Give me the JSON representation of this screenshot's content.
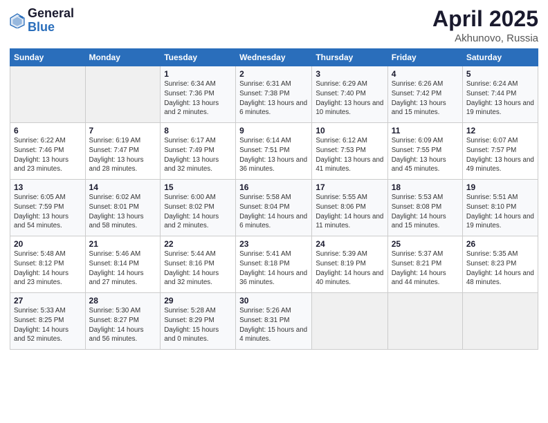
{
  "logo": {
    "general": "General",
    "blue": "Blue"
  },
  "title": {
    "month": "April 2025",
    "location": "Akhunovo, Russia"
  },
  "headers": [
    "Sunday",
    "Monday",
    "Tuesday",
    "Wednesday",
    "Thursday",
    "Friday",
    "Saturday"
  ],
  "weeks": [
    [
      {
        "day": "",
        "info": ""
      },
      {
        "day": "",
        "info": ""
      },
      {
        "day": "1",
        "info": "Sunrise: 6:34 AM\nSunset: 7:36 PM\nDaylight: 13 hours and 2 minutes."
      },
      {
        "day": "2",
        "info": "Sunrise: 6:31 AM\nSunset: 7:38 PM\nDaylight: 13 hours and 6 minutes."
      },
      {
        "day": "3",
        "info": "Sunrise: 6:29 AM\nSunset: 7:40 PM\nDaylight: 13 hours and 10 minutes."
      },
      {
        "day": "4",
        "info": "Sunrise: 6:26 AM\nSunset: 7:42 PM\nDaylight: 13 hours and 15 minutes."
      },
      {
        "day": "5",
        "info": "Sunrise: 6:24 AM\nSunset: 7:44 PM\nDaylight: 13 hours and 19 minutes."
      }
    ],
    [
      {
        "day": "6",
        "info": "Sunrise: 6:22 AM\nSunset: 7:46 PM\nDaylight: 13 hours and 23 minutes."
      },
      {
        "day": "7",
        "info": "Sunrise: 6:19 AM\nSunset: 7:47 PM\nDaylight: 13 hours and 28 minutes."
      },
      {
        "day": "8",
        "info": "Sunrise: 6:17 AM\nSunset: 7:49 PM\nDaylight: 13 hours and 32 minutes."
      },
      {
        "day": "9",
        "info": "Sunrise: 6:14 AM\nSunset: 7:51 PM\nDaylight: 13 hours and 36 minutes."
      },
      {
        "day": "10",
        "info": "Sunrise: 6:12 AM\nSunset: 7:53 PM\nDaylight: 13 hours and 41 minutes."
      },
      {
        "day": "11",
        "info": "Sunrise: 6:09 AM\nSunset: 7:55 PM\nDaylight: 13 hours and 45 minutes."
      },
      {
        "day": "12",
        "info": "Sunrise: 6:07 AM\nSunset: 7:57 PM\nDaylight: 13 hours and 49 minutes."
      }
    ],
    [
      {
        "day": "13",
        "info": "Sunrise: 6:05 AM\nSunset: 7:59 PM\nDaylight: 13 hours and 54 minutes."
      },
      {
        "day": "14",
        "info": "Sunrise: 6:02 AM\nSunset: 8:01 PM\nDaylight: 13 hours and 58 minutes."
      },
      {
        "day": "15",
        "info": "Sunrise: 6:00 AM\nSunset: 8:02 PM\nDaylight: 14 hours and 2 minutes."
      },
      {
        "day": "16",
        "info": "Sunrise: 5:58 AM\nSunset: 8:04 PM\nDaylight: 14 hours and 6 minutes."
      },
      {
        "day": "17",
        "info": "Sunrise: 5:55 AM\nSunset: 8:06 PM\nDaylight: 14 hours and 11 minutes."
      },
      {
        "day": "18",
        "info": "Sunrise: 5:53 AM\nSunset: 8:08 PM\nDaylight: 14 hours and 15 minutes."
      },
      {
        "day": "19",
        "info": "Sunrise: 5:51 AM\nSunset: 8:10 PM\nDaylight: 14 hours and 19 minutes."
      }
    ],
    [
      {
        "day": "20",
        "info": "Sunrise: 5:48 AM\nSunset: 8:12 PM\nDaylight: 14 hours and 23 minutes."
      },
      {
        "day": "21",
        "info": "Sunrise: 5:46 AM\nSunset: 8:14 PM\nDaylight: 14 hours and 27 minutes."
      },
      {
        "day": "22",
        "info": "Sunrise: 5:44 AM\nSunset: 8:16 PM\nDaylight: 14 hours and 32 minutes."
      },
      {
        "day": "23",
        "info": "Sunrise: 5:41 AM\nSunset: 8:18 PM\nDaylight: 14 hours and 36 minutes."
      },
      {
        "day": "24",
        "info": "Sunrise: 5:39 AM\nSunset: 8:19 PM\nDaylight: 14 hours and 40 minutes."
      },
      {
        "day": "25",
        "info": "Sunrise: 5:37 AM\nSunset: 8:21 PM\nDaylight: 14 hours and 44 minutes."
      },
      {
        "day": "26",
        "info": "Sunrise: 5:35 AM\nSunset: 8:23 PM\nDaylight: 14 hours and 48 minutes."
      }
    ],
    [
      {
        "day": "27",
        "info": "Sunrise: 5:33 AM\nSunset: 8:25 PM\nDaylight: 14 hours and 52 minutes."
      },
      {
        "day": "28",
        "info": "Sunrise: 5:30 AM\nSunset: 8:27 PM\nDaylight: 14 hours and 56 minutes."
      },
      {
        "day": "29",
        "info": "Sunrise: 5:28 AM\nSunset: 8:29 PM\nDaylight: 15 hours and 0 minutes."
      },
      {
        "day": "30",
        "info": "Sunrise: 5:26 AM\nSunset: 8:31 PM\nDaylight: 15 hours and 4 minutes."
      },
      {
        "day": "",
        "info": ""
      },
      {
        "day": "",
        "info": ""
      },
      {
        "day": "",
        "info": ""
      }
    ]
  ]
}
